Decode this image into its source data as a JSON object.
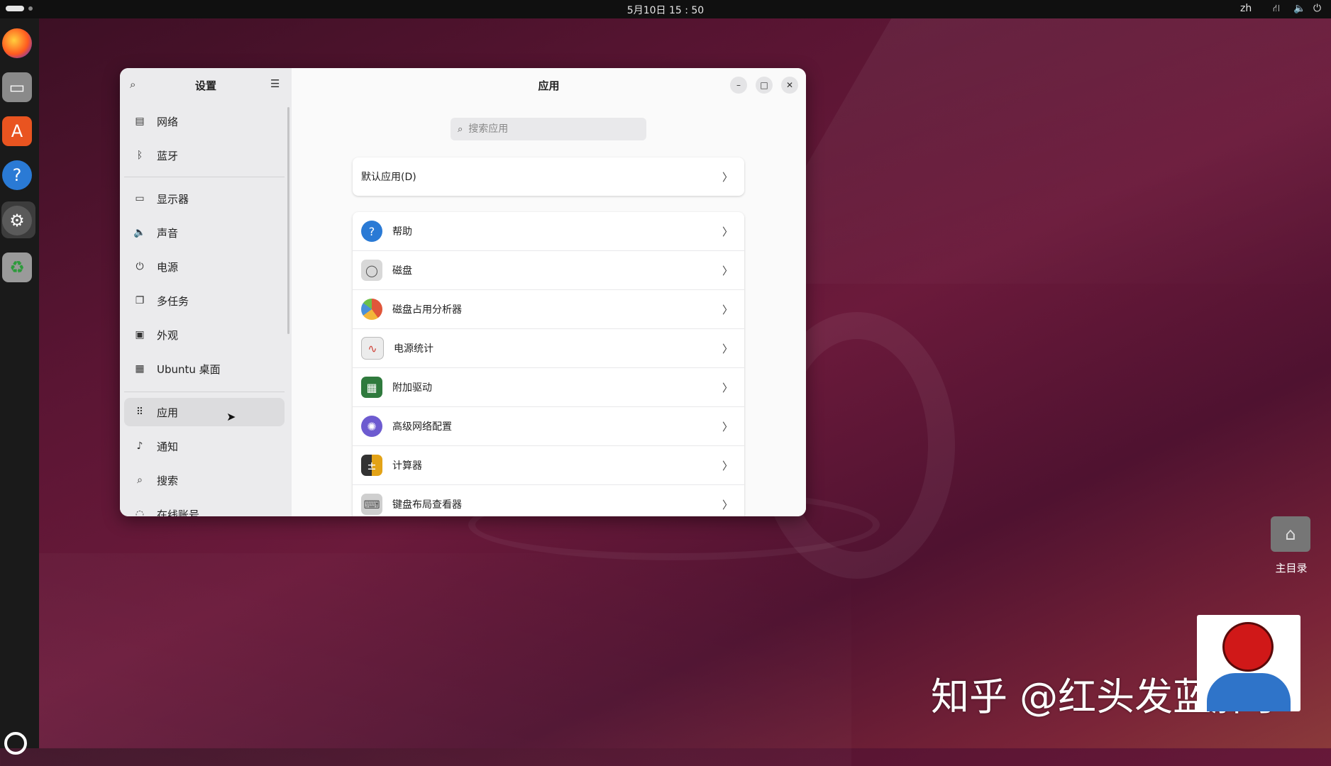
{
  "topbar": {
    "clock": "5月10日  15 : 50",
    "language": "zh",
    "icons": [
      "network-icon",
      "volume-icon",
      "power-icon"
    ]
  },
  "dock": {
    "apps": [
      "firefox-icon",
      "files-icon",
      "app-center-icon",
      "help-icon",
      "settings-icon",
      "trash-icon"
    ],
    "active": "settings-icon"
  },
  "settings": {
    "sidebar_title": "设置",
    "items": [
      {
        "label": "网络",
        "icon": "network-icon"
      },
      {
        "label": "蓝牙",
        "icon": "bluetooth-icon"
      },
      {
        "label": "显示器",
        "icon": "display-icon"
      },
      {
        "label": "声音",
        "icon": "sound-icon"
      },
      {
        "label": "电源",
        "icon": "power-icon"
      },
      {
        "label": "多任务",
        "icon": "multitasking-icon"
      },
      {
        "label": "外观",
        "icon": "appearance-icon"
      },
      {
        "label": "Ubuntu 桌面",
        "icon": "ubuntu-desktop-icon"
      },
      {
        "label": "应用",
        "icon": "apps-grid-icon"
      },
      {
        "label": "通知",
        "icon": "bell-icon"
      },
      {
        "label": "搜索",
        "icon": "search-icon"
      },
      {
        "label": "在线账号",
        "icon": "online-accounts-icon"
      }
    ],
    "selected_item": "应用"
  },
  "main": {
    "title": "应用",
    "search_placeholder": "搜索应用",
    "default_apps_label": "默认应用(D)",
    "apps": [
      {
        "label": "帮助",
        "icon": "help-icon",
        "color": "#2a7ad5"
      },
      {
        "label": "磁盘",
        "icon": "disks-icon",
        "color": "#d8d8d8"
      },
      {
        "label": "磁盘占用分析器",
        "icon": "disk-usage-icon",
        "color": "#e0563a"
      },
      {
        "label": "电源统计",
        "icon": "power-statistics-icon",
        "color": "#e8e8e8"
      },
      {
        "label": "附加驱动",
        "icon": "drivers-chip-icon",
        "color": "#2f7a3d"
      },
      {
        "label": "高级网络配置",
        "icon": "network-config-icon",
        "color": "#6d5bd0"
      },
      {
        "label": "计算器",
        "icon": "calculator-icon",
        "color": "#e3a317"
      },
      {
        "label": "键盘布局查看器",
        "icon": "keyboard-icon",
        "color": "#cfcfcf"
      }
    ]
  },
  "desktop": {
    "home_label": "主目录"
  },
  "watermark": {
    "text": "知乎 @红头发蓝胖子"
  }
}
